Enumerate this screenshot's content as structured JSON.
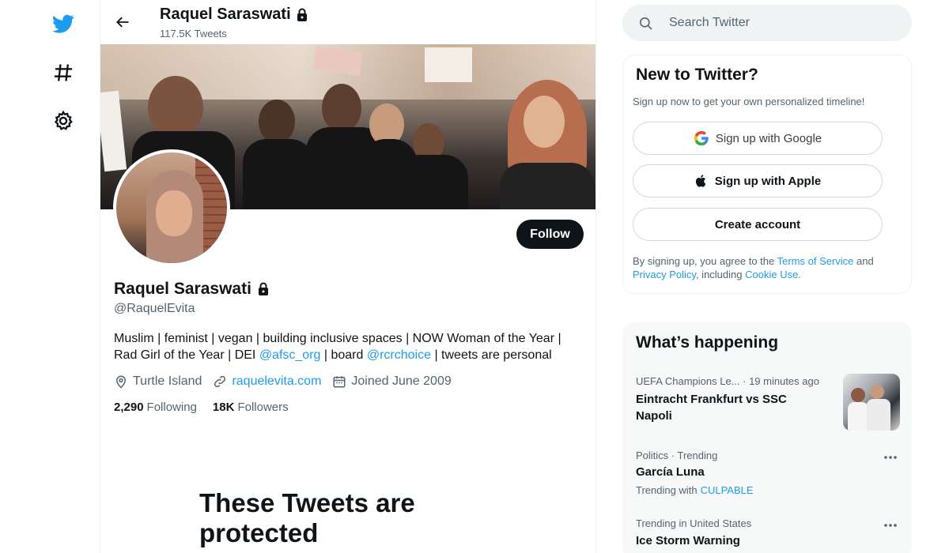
{
  "profile": {
    "name": "Raquel Saraswati",
    "tweet_count": "117.5K Tweets",
    "handle": "@RaquelEvita",
    "bio": {
      "part1": "Muslim | feminist | vegan | building inclusive spaces | NOW Woman of the Year | Rad Girl of the Year | DEI ",
      "link1": "@afsc_org",
      "part2": " | board ",
      "link2": "@rcrchoice",
      "part3": " | tweets are personal"
    },
    "location": "Turtle Island",
    "website": "raquelevita.com",
    "joined": "Joined June 2009",
    "following_count": "2,290",
    "following_label": "Following",
    "followers_count": "18K",
    "followers_label": "Followers",
    "follow_label": "Follow",
    "protected_text": "These Tweets are protected"
  },
  "search": {
    "placeholder": "Search Twitter"
  },
  "signup": {
    "title": "New to Twitter?",
    "subtitle": "Sign up now to get your own personalized timeline!",
    "google_label": "Sign up with Google",
    "apple_label": "Sign up with Apple",
    "create_label": "Create account",
    "terms_prefix": "By signing up, you agree to the ",
    "terms_link": "Terms of Service",
    "terms_and": " and ",
    "privacy_link": "Privacy Policy",
    "terms_including": ", including ",
    "cookie_link": "Cookie Use."
  },
  "happening": {
    "title": "What’s happening",
    "trends": [
      {
        "context": "UEFA Champions Le... · 19 minutes ago",
        "title": "Eintracht Frankfurt vs SSC Napoli"
      },
      {
        "context": "Politics · Trending",
        "title": "García Luna",
        "sub_prefix": "Trending with",
        "sub_link": "CULPABLE"
      },
      {
        "context": "Trending in United States",
        "title": "Ice Storm Warning"
      }
    ]
  },
  "colors": {
    "accent": "#1d9bf0",
    "text": "#0f1419",
    "muted": "#536471",
    "twitter_blue": "#1d9bf0"
  }
}
